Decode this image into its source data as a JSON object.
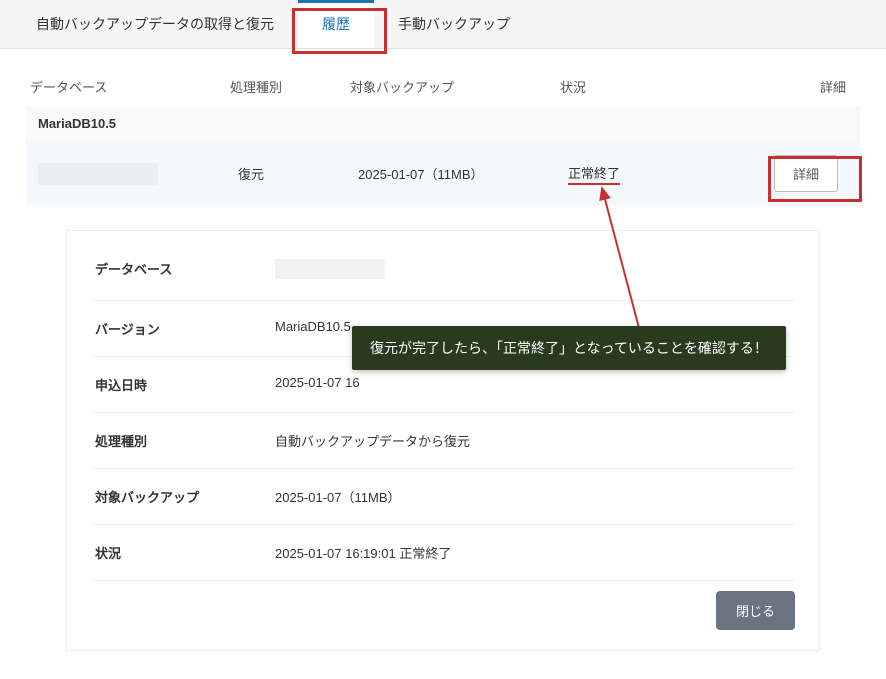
{
  "tabs": {
    "auto": "自動バックアップデータの取得と復元",
    "history": "履歴",
    "manual": "手動バックアップ"
  },
  "headers": {
    "database": "データベース",
    "type": "処理種別",
    "target": "対象バックアップ",
    "status": "状況",
    "detail": "詳細"
  },
  "group": {
    "name": "MariaDB10.5"
  },
  "row": {
    "type": "復元",
    "target": "2025-01-07（11MB）",
    "status": "正常終了",
    "detailBtn": "詳細"
  },
  "fields": {
    "databaseLabel": "データベース",
    "versionLabel": "バージョン",
    "versionValue": "MariaDB10.5",
    "applyLabel": "申込日時",
    "applyValue": "2025-01-07 16",
    "typeLabel": "処理種別",
    "typeValue": "自動バックアップデータから復元",
    "targetLabel": "対象バックアップ",
    "targetValue": "2025-01-07（11MB）",
    "statusLabel": "状況",
    "statusValue": "2025-01-07 16:19:01 正常終了"
  },
  "closeBtn": "閉じる",
  "callout": "復元が完了したら、「正常終了」となっていることを確認する！"
}
